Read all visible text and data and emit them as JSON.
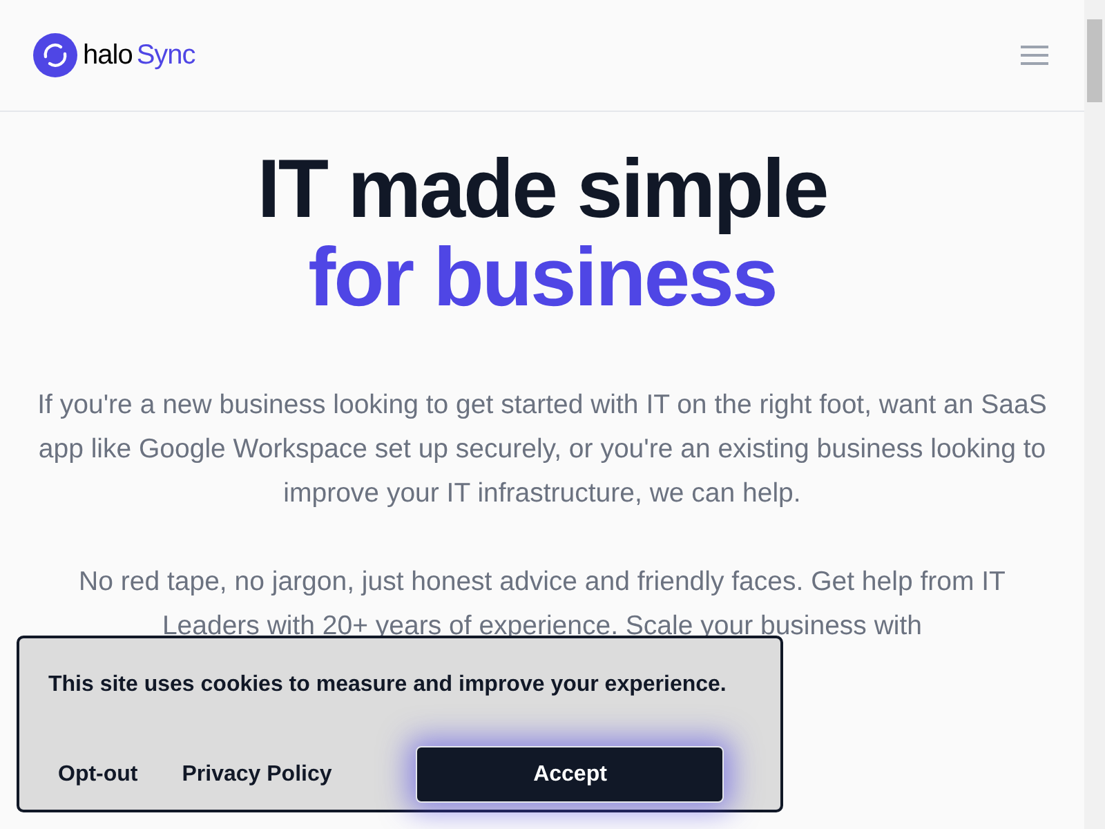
{
  "header": {
    "logo": {
      "part_1": "halo",
      "part_2": "Sync"
    }
  },
  "hero": {
    "title_line_1": "IT made simple",
    "title_line_2": "for business",
    "paragraphs": [
      "If you're a new business looking to get started with IT on the right foot, want an SaaS app like Google Workspace set up securely, or you're an existing business looking to improve your IT infrastructure, we can help.",
      "No red tape, no jargon, just honest advice and friendly faces. Get help from IT Leaders with 20+ years of experience. Scale your business with"
    ]
  },
  "cookie_banner": {
    "message": "This site uses cookies to measure and improve your experience.",
    "links": [
      "Opt-out",
      "Privacy Policy"
    ],
    "accept": "Accept"
  }
}
